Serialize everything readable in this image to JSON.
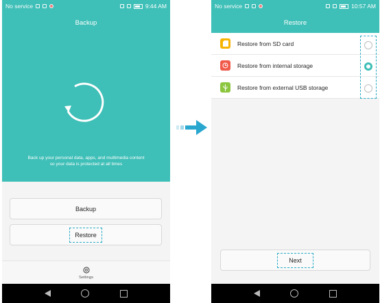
{
  "left": {
    "status": {
      "carrier": "No service",
      "time": "9:44 AM"
    },
    "title": "Backup",
    "description_line1": "Back up your personal data, apps, and multimedia content",
    "description_line2": "so your data is protected at all times",
    "buttons": {
      "backup": "Backup",
      "restore": "Restore"
    },
    "settings_label": "Settings"
  },
  "right": {
    "status": {
      "carrier": "No service",
      "time": "10:57 AM"
    },
    "title": "Restore",
    "options": [
      {
        "label": "Restore from SD card",
        "icon": "sd-card-icon",
        "color": "#f6b400",
        "selected": false
      },
      {
        "label": "Restore from internal storage",
        "icon": "clock-icon",
        "color": "#f05a4b",
        "selected": true
      },
      {
        "label": "Restore from external USB storage",
        "icon": "usb-icon",
        "color": "#8cc63f",
        "selected": false
      }
    ],
    "next_label": "Next"
  },
  "colors": {
    "accent": "#3ebfb7",
    "highlight_dash": "#27a9c5",
    "flow_arrow": "#2aa7cf"
  }
}
